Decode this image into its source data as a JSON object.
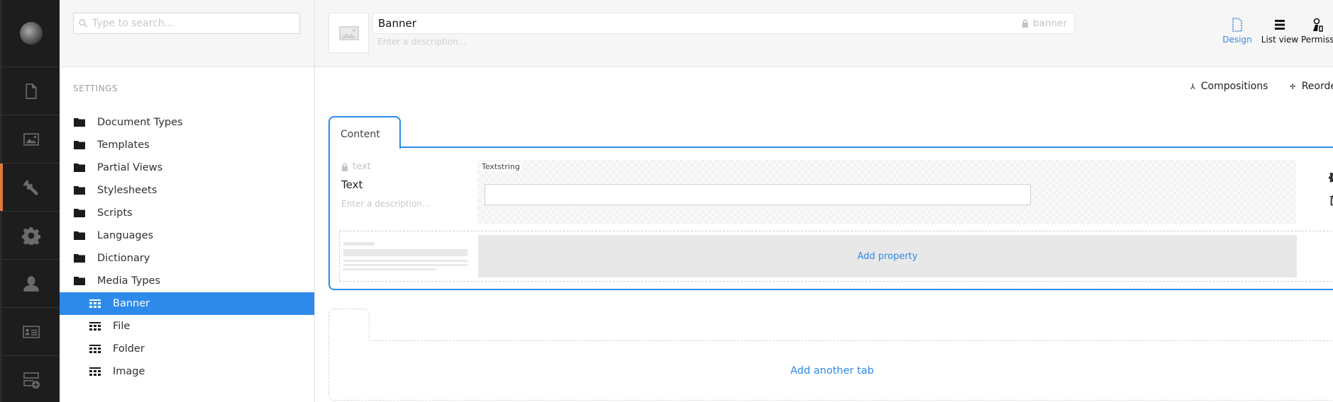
{
  "sections": {
    "items": [
      {
        "name": "content",
        "icon": "document-icon",
        "active": false
      },
      {
        "name": "media",
        "icon": "image-icon",
        "active": false
      },
      {
        "name": "settings",
        "icon": "wrench-icon",
        "active": true
      },
      {
        "name": "developer",
        "icon": "gear-icon",
        "active": false
      },
      {
        "name": "users",
        "icon": "user-icon",
        "active": false
      },
      {
        "name": "members",
        "icon": "id-card-icon",
        "active": false
      },
      {
        "name": "forms",
        "icon": "form-add-icon",
        "active": false
      }
    ],
    "accent_color": "#e07b39"
  },
  "tree": {
    "search_placeholder": "Type to search...",
    "section_title": "SETTINGS",
    "items": [
      {
        "label": "Document Types",
        "icon": "folder-icon"
      },
      {
        "label": "Templates",
        "icon": "folder-icon"
      },
      {
        "label": "Partial Views",
        "icon": "folder-icon"
      },
      {
        "label": "Stylesheets",
        "icon": "folder-icon"
      },
      {
        "label": "Scripts",
        "icon": "folder-icon"
      },
      {
        "label": "Languages",
        "icon": "folder-icon"
      },
      {
        "label": "Dictionary",
        "icon": "folder-icon"
      },
      {
        "label": "Media Types",
        "icon": "folder-icon"
      }
    ],
    "children": [
      {
        "label": "Banner",
        "icon": "media-type-icon",
        "selected": true
      },
      {
        "label": "File",
        "icon": "media-type-icon",
        "selected": false
      },
      {
        "label": "Folder",
        "icon": "media-type-icon",
        "selected": false
      },
      {
        "label": "Image",
        "icon": "media-type-icon",
        "selected": false
      }
    ],
    "selected_color": "#2e8aea"
  },
  "header": {
    "name": "Banner",
    "alias": "banner",
    "description_placeholder": "Enter a description...",
    "apps": [
      {
        "label": "Design",
        "icon": "design-icon",
        "active": true
      },
      {
        "label": "List view",
        "icon": "list-icon",
        "active": false
      },
      {
        "label": "Permissions",
        "icon": "permissions-icon",
        "active": false
      }
    ]
  },
  "toolbar": {
    "compositions_label": "Compositions",
    "reorder_label": "Reorder"
  },
  "tabs": [
    {
      "label": "Content",
      "properties": [
        {
          "alias": "text",
          "label": "Text",
          "description_placeholder": "Enter a description...",
          "editor": "Textstring",
          "value": ""
        }
      ],
      "add_property_label": "Add property"
    }
  ],
  "add_tab_label": "Add another tab",
  "accent_color": "#2e8aea"
}
